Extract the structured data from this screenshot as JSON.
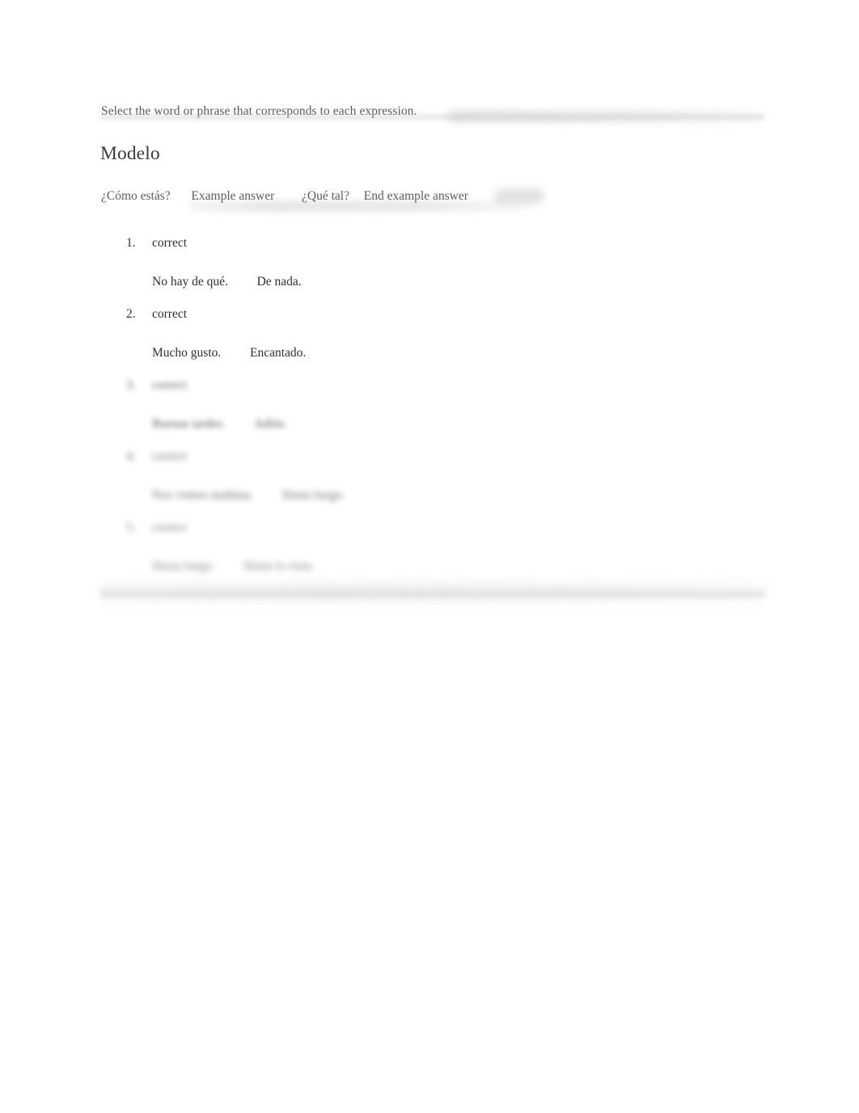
{
  "document": {
    "instruction": "Select the word or phrase that corresponds to each expression.",
    "heading": "Modelo"
  },
  "modelo": {
    "prompt": "¿Cómo estás?",
    "example_answer_label": "Example answer",
    "answer": "¿Qué tal?",
    "end_example_answer_label": "End example answer"
  },
  "questions": [
    {
      "number": "1.",
      "label": "correct",
      "options": [
        "No hay de qué.",
        "De nada."
      ],
      "visible": true
    },
    {
      "number": "2.",
      "label": "correct",
      "options": [
        "Mucho gusto.",
        "Encantado."
      ],
      "visible": true
    },
    {
      "number": "3.",
      "label": "correct",
      "options": [
        "Buenas tardes.",
        "Adiós."
      ],
      "visible": false
    },
    {
      "number": "4.",
      "label": "correct",
      "options": [
        "Nos vemos mañana.",
        "Hasta luego."
      ],
      "visible": false
    },
    {
      "number": "5.",
      "label": "correct",
      "options": [
        "Hasta luego.",
        "Hasta la vista."
      ],
      "visible": false
    }
  ],
  "colors": {
    "page_background": "#ffffff",
    "instruction_text": "#58585c",
    "heading_text": "#3b3b3d",
    "body_text": "#2f2f31",
    "muted_text": "#5c5c60",
    "divider_band": "#c4c4c7"
  }
}
